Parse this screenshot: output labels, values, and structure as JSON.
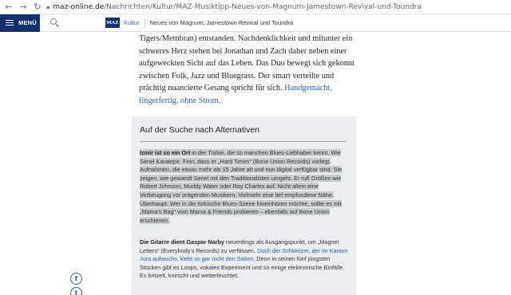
{
  "browser": {
    "host": "maz-online.de",
    "path": "/Nachrichten/Kultur/MAZ-Musiktipp-Neues-von-Magnum-Jamestown-Revival-und-Toundra"
  },
  "header": {
    "menu_label": "MENÜ",
    "logo_text": "MAZ",
    "rubrik": "Kultur",
    "headline": "Neues von Magnum, Jamestown Revival und Toundra"
  },
  "article": {
    "top_text": "Tigers/Membran) entstanden. Nachdenklichkeit und mitunter ein schweres Herz stehen bei Jonathan und Zach daher neben einer aufgeweckten Sicht auf das Leben. Das Duo bewegt sich gekonnt zwischen Folk, Jazz und Bluegrass. Der smart verteilte und prächtig nuancierte Gesang spricht für sich.",
    "top_link": "Handgemacht, fingerfertig, ohne Strom",
    "top_end": "."
  },
  "infobox": {
    "title": "Auf der Suche nach Alternativen",
    "p1_bold": "Izmir ist so ein Ort",
    "p1_text": " in der Türkei, die so manchen Blues-Liebhaber kennt. Wie Senel Karatepe. Fein, dass er „Hard Times“ (Bone Union Records) vorlegt. Aufnahmen, die etwas mehr als 15 Jahre alt und nun digital verfügbar sind. Sie zeigen, wie gewandt Senel mit den Traditionalisten umgeht. Er ruft Größen wie Robert Johnson, Muddy Water oder Ray Charles auf. Nicht allein eine Verbeugung vor prägenden Musikern. Vielmehr eine tief empfundene Nähe. Überhaupt: Wer in die türkische Blues-Szene hineinhören möchte, sollte es mit „Mama’s Bag“ vom Mama & Friends probieren – ebenfalls auf Bone Union erschienen.",
    "p2_bold": "Die Gitarre dient Gaspar Narby",
    "p2_text": " neuerdings als Ausgangspunkt, um „Magnet Letters“ (Everybody’s Records) zu verfassen.",
    "p2_link": "Doch der Schweizer, der im Kanton Jura aufwuchs, klebt so gar nicht den Saiten",
    "p2_end": ". Denn in seinen fünf jüngsten Stücken gibt es Loops, vokales Experiment und so einige elektronische Einfälle. Es britzelt, knirscht und wetterleuchtet."
  },
  "share": {
    "facebook_glyph": "f",
    "twitter_glyph": "t"
  },
  "icons": [
    "back-icon",
    "forward-icon",
    "reload-icon",
    "lock-icon",
    "menu-icon",
    "search-icon",
    "facebook-icon",
    "twitter-icon"
  ],
  "colors": {
    "brand": "#13316b",
    "link": "#2b5ea8",
    "box_bg": "#ebedf0",
    "highlight": "#c9ccd1"
  }
}
